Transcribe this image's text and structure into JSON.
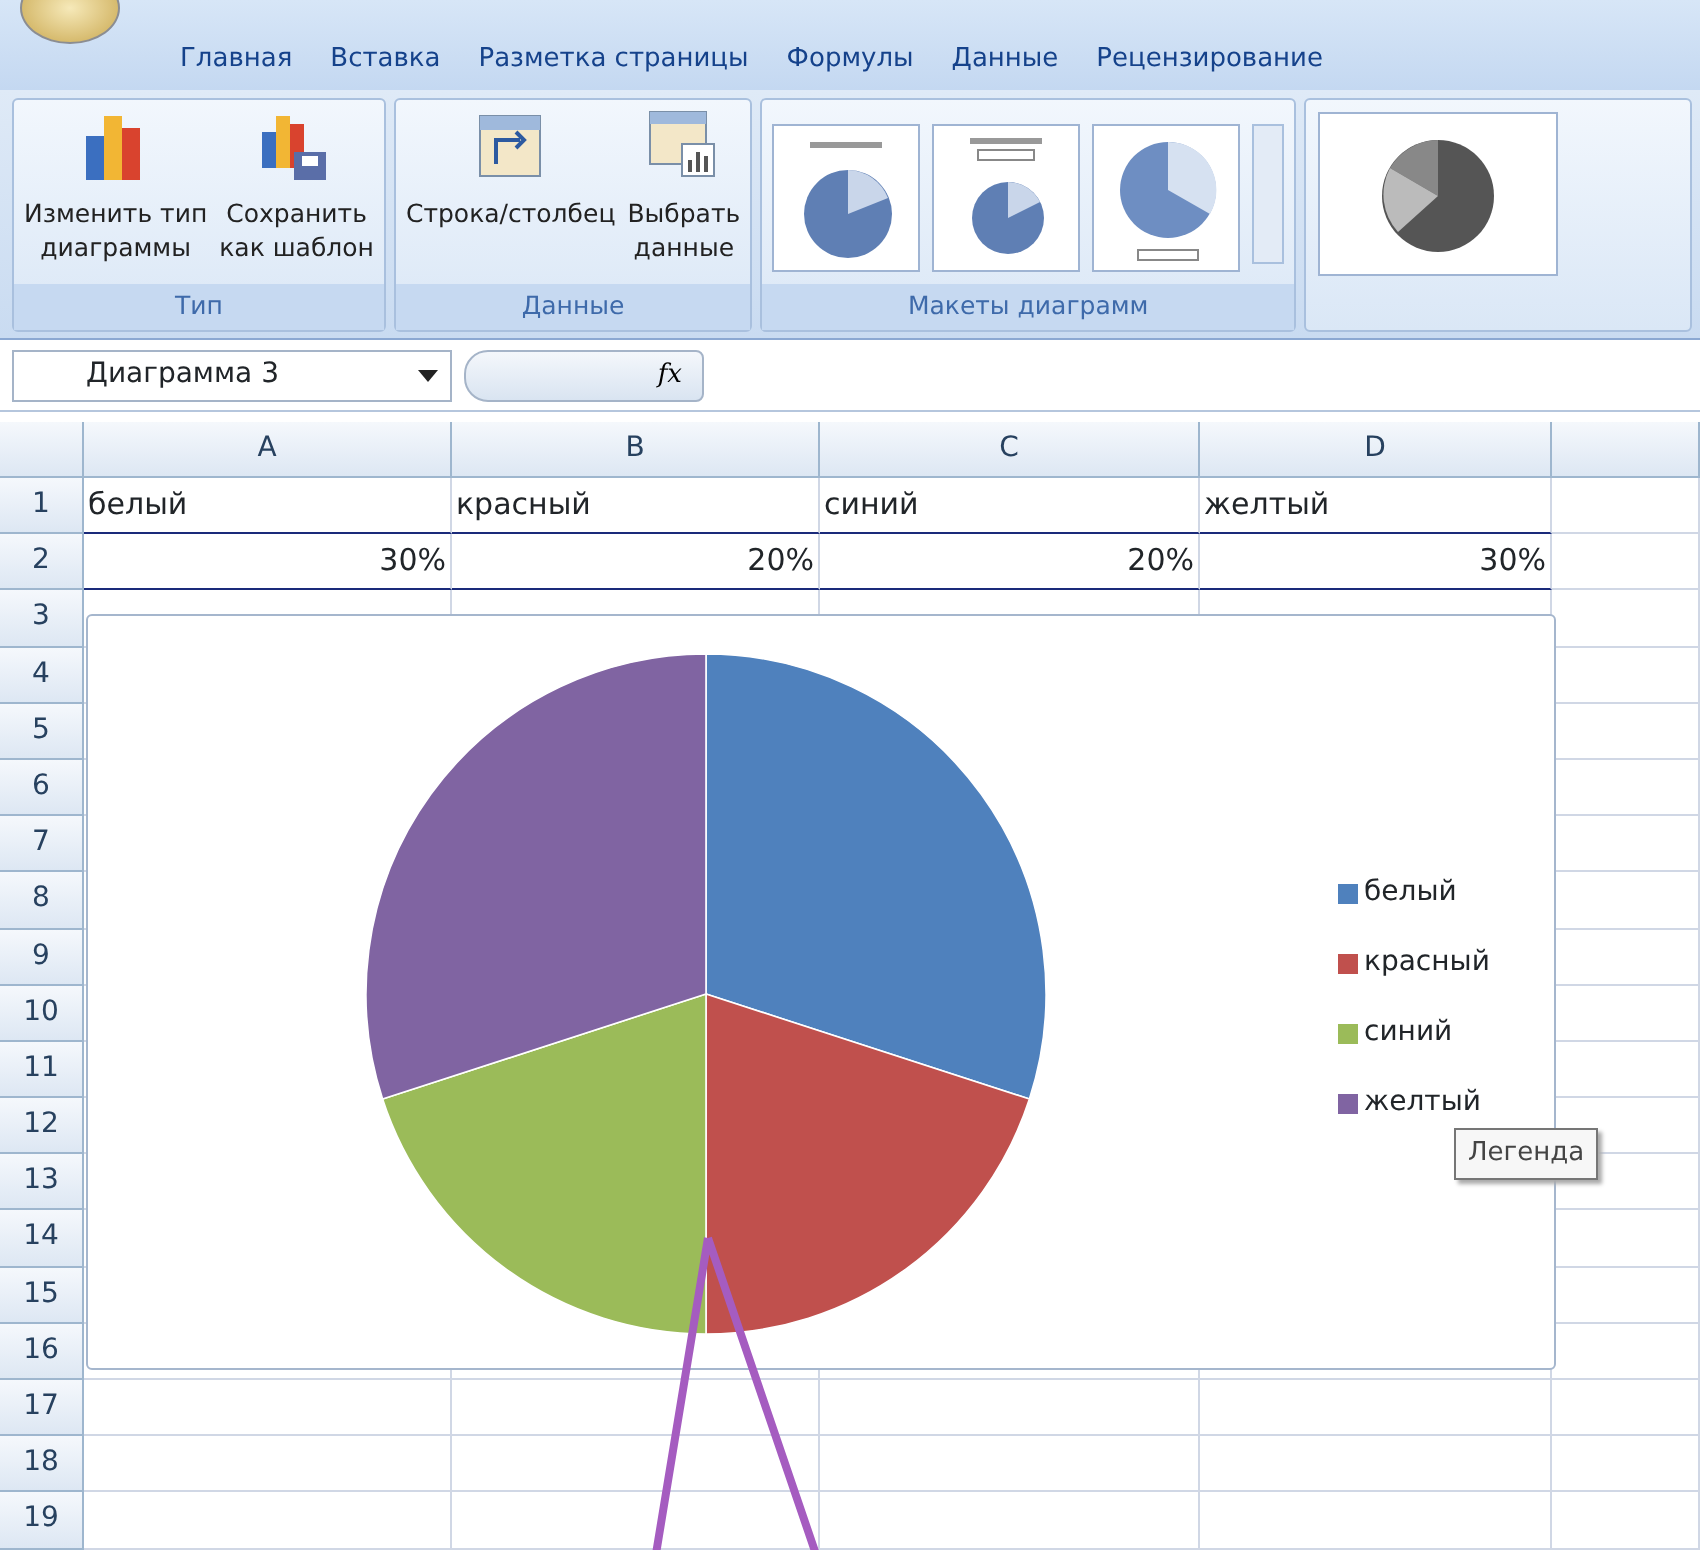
{
  "ribbon_tabs": [
    "Главная",
    "Вставка",
    "Разметка страницы",
    "Формулы",
    "Данные",
    "Рецензирование"
  ],
  "ribbon_groups": [
    {
      "title": "Тип",
      "buttons": [
        {
          "kind": "change-type",
          "lines": [
            "Изменить тип",
            "диаграммы"
          ]
        },
        {
          "kind": "save-template",
          "lines": [
            "Сохранить",
            "как шаблон"
          ]
        }
      ]
    },
    {
      "title": "Данные",
      "buttons": [
        {
          "kind": "switch",
          "lines": [
            "Строка/столбец"
          ]
        },
        {
          "kind": "select-data",
          "lines": [
            "Выбрать",
            "данные"
          ]
        }
      ]
    },
    {
      "title": "Макеты диаграмм",
      "thumbnails": [
        {
          "kind": "title-pie"
        },
        {
          "kind": "boxed-pie"
        },
        {
          "kind": "plain-pie"
        }
      ]
    }
  ],
  "name_box": {
    "value": "Диаграмма 3"
  },
  "formula_bar": {
    "function_label": "fx"
  },
  "sheet": {
    "columns": [
      "A",
      "B",
      "C",
      "D"
    ],
    "rows": [
      {
        "number": "1",
        "highlighted": true,
        "kind": "text",
        "cells": [
          "белый",
          "красный",
          "синий",
          "желтый"
        ]
      },
      {
        "number": "2",
        "highlighted": true,
        "kind": "number",
        "cells": [
          "30%",
          "20%",
          "20%",
          "30%"
        ]
      },
      {
        "number": "3"
      },
      {
        "number": "4"
      },
      {
        "number": "5"
      },
      {
        "number": "6"
      },
      {
        "number": "7"
      },
      {
        "number": "8"
      },
      {
        "number": "9"
      },
      {
        "number": "10"
      },
      {
        "number": "11"
      },
      {
        "number": "12"
      },
      {
        "number": "13"
      },
      {
        "number": "14"
      },
      {
        "number": "15"
      },
      {
        "number": "16"
      },
      {
        "number": "17"
      },
      {
        "number": "18"
      },
      {
        "number": "19"
      }
    ]
  },
  "chart": {
    "chart_data": {
      "type": "pie",
      "categories": [
        "белый",
        "красный",
        "синий",
        "желтый"
      ],
      "series": [
        {
          "values": [
            30,
            20,
            20,
            30
          ]
        }
      ],
      "colors": [
        "#4f81bd",
        "#c0504d",
        "#9bbb59",
        "#8064a2"
      ],
      "legend": "right"
    },
    "tooltip": "Легенда"
  }
}
